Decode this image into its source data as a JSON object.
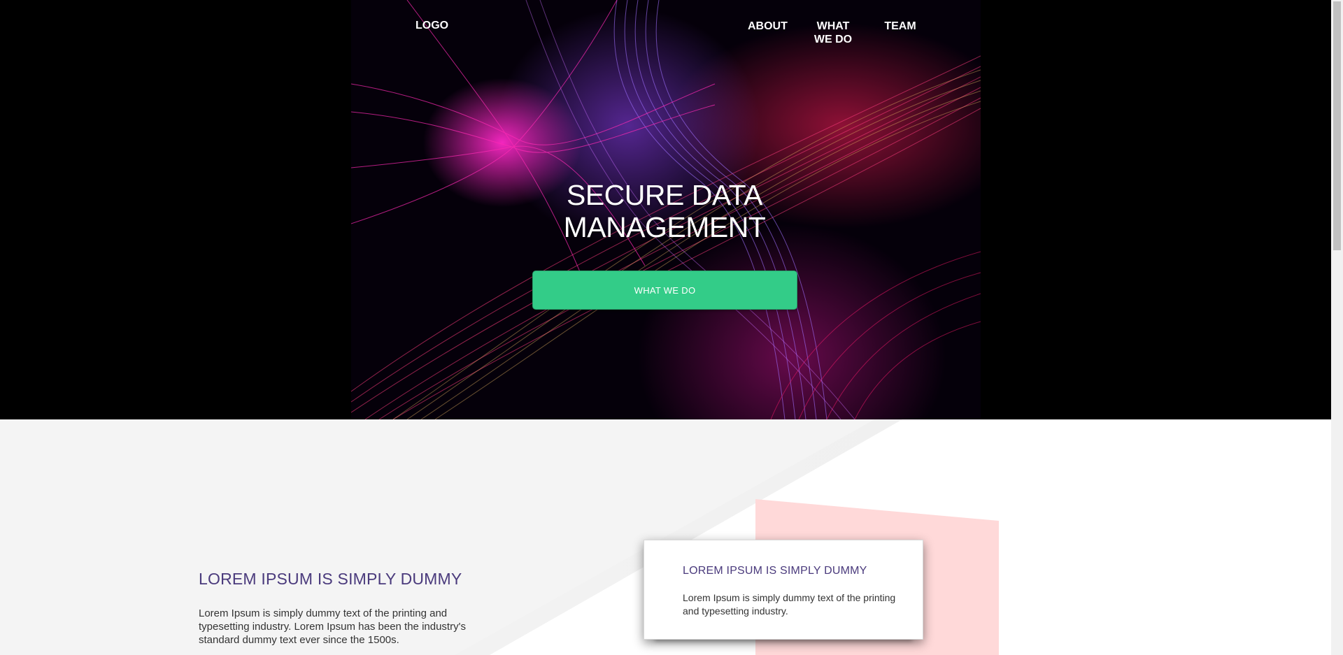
{
  "nav": {
    "logo": "LOGO",
    "links": [
      {
        "label": "ABOUT"
      },
      {
        "label": "WHAT WE DO"
      },
      {
        "label": "TEAM"
      }
    ]
  },
  "hero": {
    "title": "SECURE DATA MANAGEMENT",
    "cta_label": "WHAT WE DO"
  },
  "content": {
    "heading": "LOREM IPSUM IS SIMPLY DUMMY",
    "body": "Lorem Ipsum is simply dummy text of the printing and typesetting industry. Lorem Ipsum has been the industry's standard dummy text ever since the 1500s.",
    "card": {
      "heading": "LOREM IPSUM IS SIMPLY DUMMY",
      "body": "Lorem Ipsum is simply dummy text of the printing and typesetting industry."
    }
  },
  "colors": {
    "cta": "#33cc88",
    "heading": "#4a3a7c",
    "accent_pink": "#ffd9d9"
  }
}
